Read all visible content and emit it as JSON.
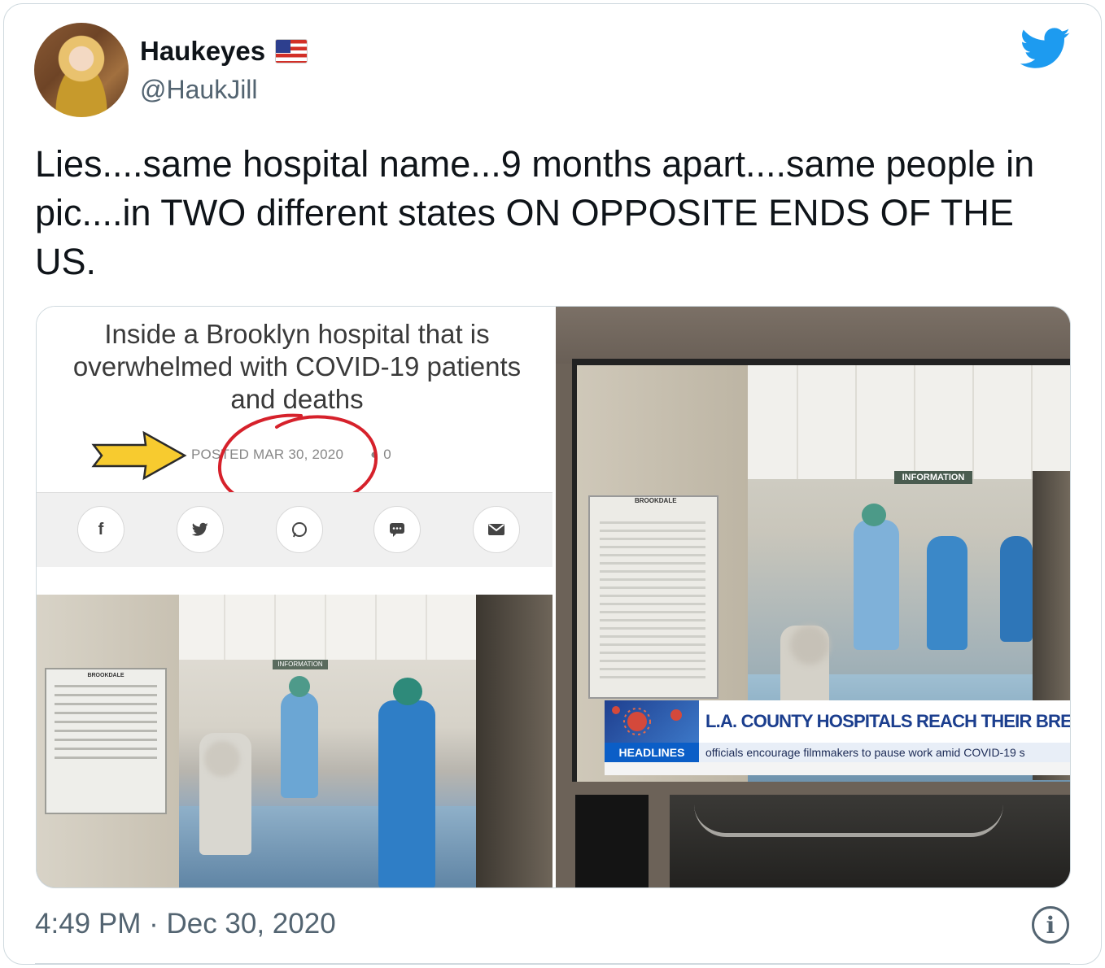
{
  "user": {
    "display_name": "Haukeyes",
    "handle": "@HaukJill",
    "flag_icon": "us-flag-icon"
  },
  "brand": {
    "logo_icon": "twitter-bird-icon",
    "color": "#1d9bf0"
  },
  "tweet": {
    "text": "Lies....same hospital name...9 months apart....same people in pic....in TWO different states ON OPPOSITE ENDS OF THE US.",
    "timestamp": "4:49 PM · Dec 30, 2020"
  },
  "left_image": {
    "article_title": "Inside a Brooklyn hospital that is overwhelmed with COVID-19 patients and deaths",
    "posted": "POSTED MAR 30, 2020",
    "comment_count": "0",
    "share_icons": [
      "facebook-icon",
      "twitter-icon",
      "whatsapp-icon",
      "sms-icon",
      "email-icon"
    ],
    "photo_sign": "INFORMATION",
    "board_label": "BROOKDALE"
  },
  "right_image": {
    "board_label": "BROOKDALE",
    "sign": "INFORMATION",
    "chyron_headline": "L.A. COUNTY HOSPITALS REACH THEIR BREAKING POINT",
    "chyron_tag": "HEADLINES",
    "chyron_sub": "officials encourage filmmakers to pause work amid COVID-19 s"
  },
  "info_label": "i"
}
